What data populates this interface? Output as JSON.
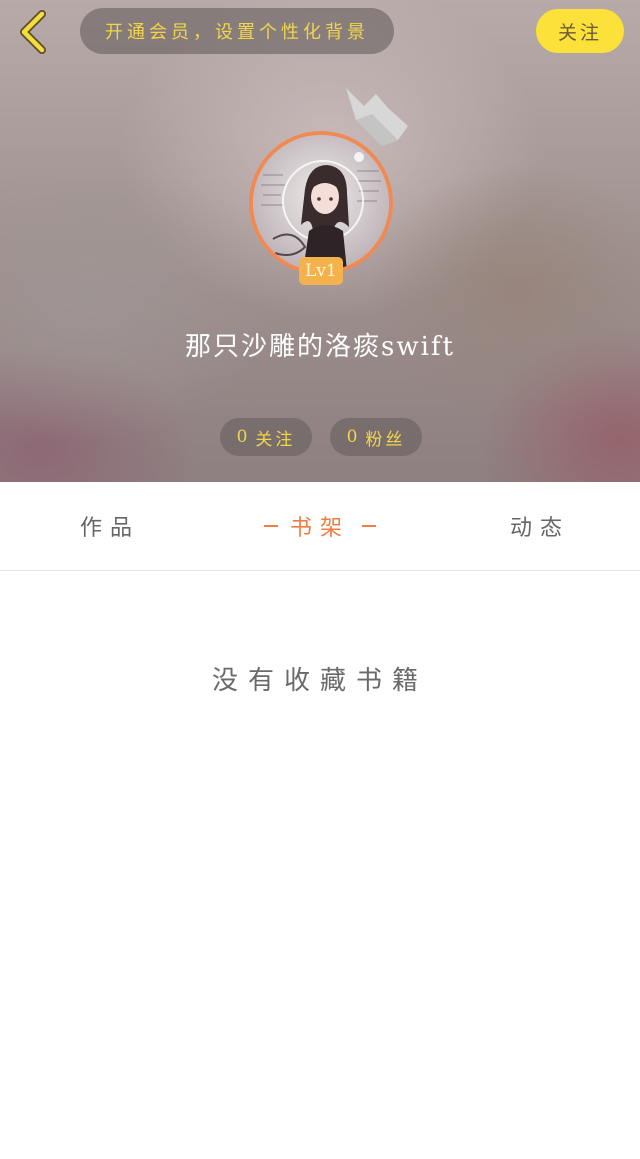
{
  "header": {
    "back_icon": "chevron-left-icon",
    "vip_banner_label": "开通会员，设置个性化背景",
    "follow_button_label": "关注",
    "crown_icon": "crown-icon",
    "level_badge": "Lv1",
    "username": "那只沙雕的洛痰swift",
    "stats": {
      "following": {
        "count": "0",
        "label": "关注"
      },
      "fans": {
        "count": "0",
        "label": "粉丝"
      }
    },
    "colors": {
      "accent_yellow": "#fbe13a",
      "banner_text": "#f2d64a",
      "avatar_ring": "#f08a55",
      "badge": "#f3b24c"
    }
  },
  "tabs": {
    "items": [
      {
        "label": "作品"
      },
      {
        "label": "书架",
        "active": true
      },
      {
        "label": "动态"
      }
    ],
    "active_color": "#f07d44"
  },
  "content": {
    "empty_message": "没有收藏书籍"
  }
}
